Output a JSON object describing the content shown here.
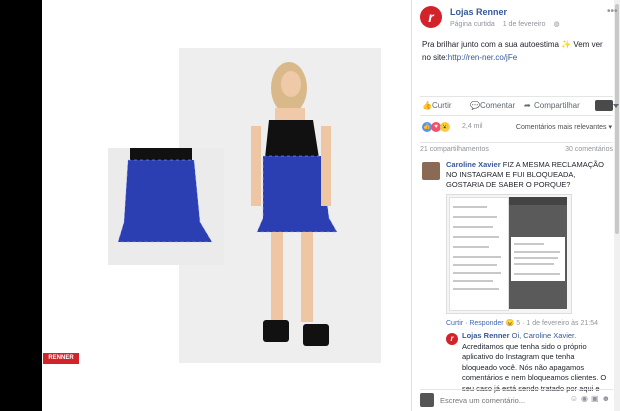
{
  "photo": {
    "brand_badge": "RENNER"
  },
  "post": {
    "page_name": "Lojas Renner",
    "page_type": "Página curtida",
    "date": "1 de fevereiro",
    "globe_icon": "globe-icon",
    "text": "Pra brilhar junto com a sua autoestima ✨ Vem ver no site:",
    "link": "http://ren-ner.co/jFe"
  },
  "actions": {
    "like": "Curtir",
    "comment": "Comentar",
    "share": "Compartilhar"
  },
  "reactions": {
    "count": "2,4 mil",
    "relevance": "Comentários mais relevantes ▾"
  },
  "stats": {
    "shares": "21 compartilhamentos",
    "comments": "30 comentários"
  },
  "comment1": {
    "author": "Caroline Xavier",
    "text": "FIZ A MESMA RECLAMAÇÃO NO INSTAGRAM E FUI BLOQUEADA, GOSTARIA DE SABER O PORQUE?",
    "meta_like": "Curtir",
    "meta_reply": "Responder",
    "meta_count": "5",
    "meta_time": "1 de fevereiro às 21:54"
  },
  "reply1": {
    "author": "Lojas Renner",
    "tag": "Oi, Caroline Xavier.",
    "text": "Acreditamos que tenha sido o próprio aplicativo do Instagram que tenha bloqueado você. Nós não apagamos comentários e nem bloqueamos clientes. O seu caso já está sendo tratado por aqui e"
  },
  "composer": {
    "placeholder": "Escreva um comentário..."
  },
  "colors": {
    "brand": "#d2232a",
    "link": "#365899",
    "like": "#4267b2"
  }
}
